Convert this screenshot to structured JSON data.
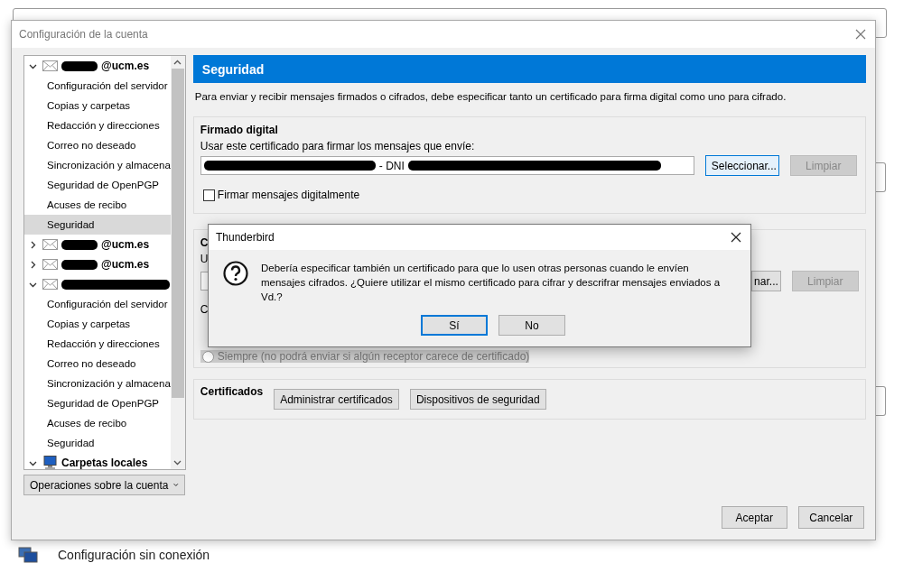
{
  "window": {
    "title": "Configuración de la cuenta"
  },
  "account_tree": [
    {
      "kind": "account",
      "label": "@ucm.es",
      "redacted": true,
      "expanded": true,
      "selected": false,
      "children": [
        {
          "label": "Configuración del servidor",
          "selected": false
        },
        {
          "label": "Copias y carpetas",
          "selected": false
        },
        {
          "label": "Redacción y direcciones",
          "selected": false
        },
        {
          "label": "Correo no deseado",
          "selected": false
        },
        {
          "label": "Sincronización y almacena",
          "selected": false
        },
        {
          "label": "Seguridad de OpenPGP",
          "selected": false
        },
        {
          "label": "Acuses de recibo",
          "selected": false
        },
        {
          "label": "Seguridad",
          "selected": true
        }
      ]
    },
    {
      "kind": "account",
      "label": "@ucm.es",
      "redacted": true,
      "expanded": false,
      "selected": false
    },
    {
      "kind": "account",
      "label": "@ucm.es",
      "redacted": true,
      "expanded": false,
      "selected": false
    },
    {
      "kind": "account",
      "redacted": true,
      "expanded": true,
      "selected": false,
      "children": [
        {
          "label": "Configuración del servidor",
          "selected": false
        },
        {
          "label": "Copias y carpetas",
          "selected": false
        },
        {
          "label": "Redacción y direcciones",
          "selected": false
        },
        {
          "label": "Correo no deseado",
          "selected": false
        },
        {
          "label": "Sincronización y almacena",
          "selected": false
        },
        {
          "label": "Seguridad de OpenPGP",
          "selected": false
        },
        {
          "label": "Acuses de recibo",
          "selected": false
        },
        {
          "label": "Seguridad",
          "selected": false
        }
      ]
    },
    {
      "kind": "local",
      "label": "Carpetas locales",
      "redacted": false,
      "expanded": true,
      "selected": false
    }
  ],
  "account_actions_button": "Operaciones sobre la cuenta",
  "panel": {
    "title": "Seguridad",
    "description": "Para enviar y recibir mensajes firmados o cifrados, debe especificar tanto un certificado para firma digital como uno para cifrado.",
    "signing": {
      "heading": "Firmado digital",
      "label": "Usar este certificado para firmar los mensajes que envíe:",
      "certificate_value": "- DNI",
      "select_button": "Seleccionar...",
      "clear_button": {
        "label": "Limpiar",
        "disabled": true
      },
      "checkbox": {
        "label": "Firmar mensajes digitalmente",
        "checked": false
      }
    },
    "encryption": {
      "heading": "C",
      "label": "U",
      "select_button": "nar...",
      "clear_button": {
        "label": "Limpiar",
        "disabled": true
      },
      "options_label": "C",
      "radio": {
        "label": "Siempre (no podrá enviar si algún receptor carece de certificado)",
        "selected": false,
        "disabled": true
      }
    },
    "certificates": {
      "heading": "Certificados",
      "buttons": [
        "Administrar certificados",
        "Dispositivos de seguridad"
      ]
    }
  },
  "footer_buttons": [
    "Aceptar",
    "Cancelar"
  ],
  "dialog": {
    "title": "Thunderbird",
    "message": "Debería especificar también un certificado para que lo usen otras personas cuando le envíen mensajes cifrados. ¿Quiere utilizar el mismo certificado para cifrar y descrifrar mensajes enviados a Vd.?",
    "buttons": [
      {
        "label": "Sí",
        "focused": true
      },
      {
        "label": "No",
        "focused": false
      }
    ]
  },
  "background": {
    "item": "Configuración sin conexión"
  }
}
